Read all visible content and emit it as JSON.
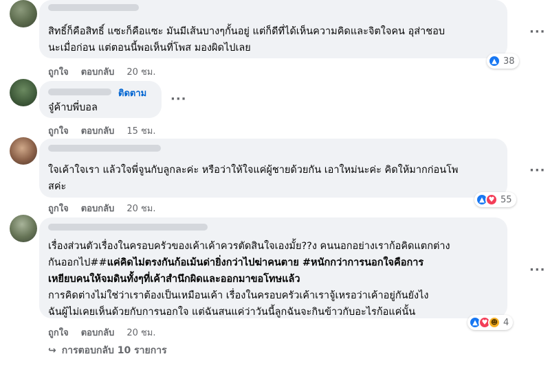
{
  "comments": [
    {
      "text": "สิทธิ์ก็คือสิทธิ์ แซะก็คือแซะ มันมีเส้นบางๆกั้นอยู่ แต่ก็ดีที่ได้เห็นความคิดและจิตใจคน อุส่าชอบ\nนะเมื่อก่อน แต่ตอนนี้พอเห็นที่โพส มองผิดไปเลย",
      "like_label": "ถูกใจ",
      "reply_label": "ตอบกลับ",
      "time": "20 ชม.",
      "reaction_count": "38",
      "reactions": [
        "like-icon"
      ]
    },
    {
      "follow_label": "ติดตาม",
      "text": "จู๋ค้าบพี่บอล",
      "like_label": "ถูกใจ",
      "reply_label": "ตอบกลับ",
      "time": "15 ชม."
    },
    {
      "text": "ใจเค้าใจเรา แล้วใจพี่จูนกับลูกละค่ะ หรือว่าให้ใจแค่ผู้ชายด้วยกัน เอาใหม่นะค่ะ คิดให้มากก่อนโพ\nสค่ะ",
      "like_label": "ถูกใจ",
      "reply_label": "ตอบกลับ",
      "time": "20 ชม.",
      "reaction_count": "55",
      "reactions": [
        "like-icon",
        "love-icon"
      ]
    },
    {
      "text_line1": "เรื่องส่วนตัวเรื่องในครอบครัวของเค้าเค้าควรตัดสินใจเองมั้ย??ง คนนอกอย่างเราก้อคิดแตกต่าง",
      "text_line2_plain": "กันออกไป##",
      "text_line2_bold": "แค่คิดไม่ตรงกันก้อเม้นด่ายิ่งกว่าไปฆ่าคนตาย #หนักกว่าการนอกใจคือการ",
      "text_line3_bold": "เหยียบคนให้จมดินทั้งๆที่เค้าสำนึกผิดและออกมาขอโทษแล้ว",
      "text_line4": "การคิดต่างไม่ใช่ว่าเราต้องเป็นเหมือนเค้า เรื่องในครอบครัวเค้าเราจู้เหรอว่าเค้าอยู่กันยังไง",
      "text_line5": "ฉันผู้ไม่เคยเห็นด้วยกับการนอกใจ แต่ฉันสนแค่ว่าวันนี้ลูกฉันจะกินข้าวกับอะไรก้อแค่นั้น",
      "like_label": "ถูกใจ",
      "reply_label": "ตอบกลับ",
      "time": "20 ชม.",
      "reaction_count": "4",
      "reactions": [
        "like-icon",
        "love-icon",
        "haha-icon"
      ],
      "view_replies_label": "การตอบกลับ 10 รายการ"
    }
  ],
  "more_label": "···"
}
